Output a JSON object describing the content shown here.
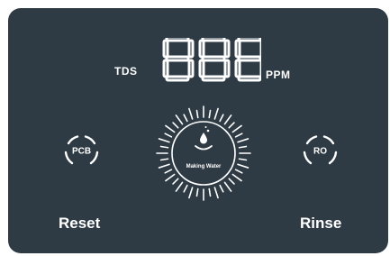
{
  "panel": {
    "display_value": "888",
    "tds_label": "TDS",
    "ppm_label": "PPM",
    "status_text": "Making Water"
  },
  "buttons": {
    "pcb_label": "PCB",
    "ro_label": "RO",
    "reset_label": "Reset",
    "rinse_label": "Rinse"
  },
  "colors": {
    "panel_bg": "#2e3b45",
    "foreground": "#ffffff"
  }
}
